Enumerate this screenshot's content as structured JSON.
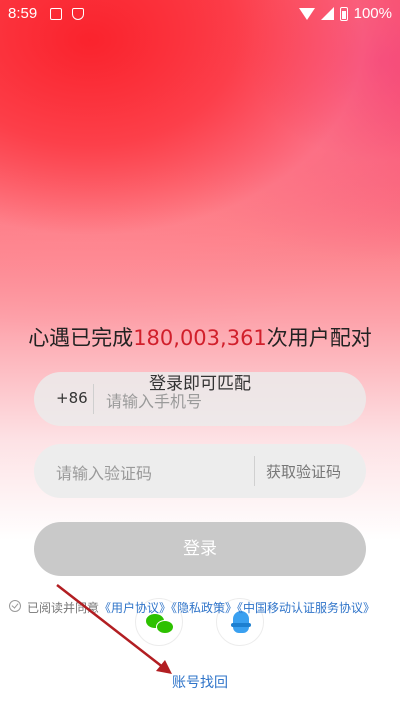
{
  "status_bar": {
    "time": "8:59",
    "battery": "100%",
    "icons": [
      "notification-a-icon",
      "shield-icon",
      "wifi-icon",
      "signal-icon",
      "battery-icon"
    ]
  },
  "headline": {
    "prefix": "心遇已完成",
    "count": "180,003,361",
    "suffix": "次用户配对"
  },
  "subline": "登录即可匹配",
  "phone": {
    "country_code": "+86",
    "placeholder": "请输入手机号"
  },
  "code": {
    "placeholder": "请输入验证码",
    "button": "获取验证码"
  },
  "login_button": "登录",
  "agreement": {
    "prefix": "已阅读并同意",
    "user_agreement": "《用户协议》",
    "privacy_policy": "《隐私政策》",
    "cmcc_agreement": "《中国移动认证服务协议》"
  },
  "social": [
    "wechat-icon",
    "qq-icon"
  ],
  "recover_link": "账号找回",
  "colors": {
    "accent_red": "#d11f2b",
    "link_blue": "#2f74c9",
    "button_disabled": "#c9c9c9",
    "annotation_arrow": "#b21e22"
  }
}
